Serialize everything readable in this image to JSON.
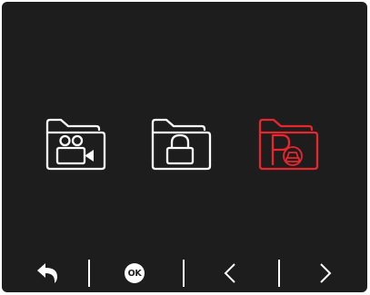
{
  "folders": [
    {
      "name": "video-folder",
      "icon": "video-camera-icon",
      "selected": false
    },
    {
      "name": "locked-folder",
      "icon": "lock-icon",
      "selected": false
    },
    {
      "name": "parking-folder",
      "icon": "parking-car-icon",
      "selected": true
    }
  ],
  "bottom_bar": {
    "back_icon": "return-arrow-icon",
    "ok_label": "OK",
    "prev_icon": "chevron-left-icon",
    "next_icon": "chevron-right-icon"
  },
  "colors": {
    "background": "#1d1d1d",
    "icon_default": "#ffffff",
    "icon_selected": "#e8262d"
  }
}
